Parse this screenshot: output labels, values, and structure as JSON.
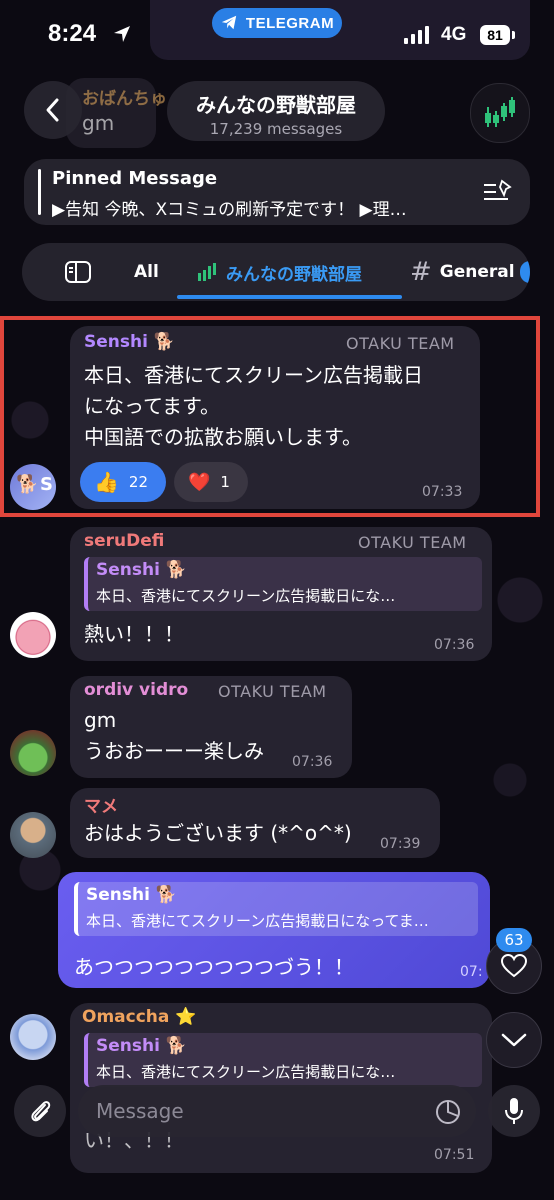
{
  "status_bar": {
    "time": "8:24",
    "network": "4G",
    "battery": "81",
    "app_pill": "TELEGRAM"
  },
  "header": {
    "title": "みんなの野獣部屋",
    "subtitle": "17,239 messages",
    "back_icon": "chevron-left-icon",
    "right_icon": "candlestick-chart-icon"
  },
  "behind_header": {
    "sender": "おばんちゅ",
    "text": "gm"
  },
  "pinned": {
    "title": "Pinned Message",
    "text": "▶告知 今晩、Xコミュの刷新予定です！ ▶理…"
  },
  "tabs": [
    {
      "label": "All",
      "icon": "sidebar-icon"
    },
    {
      "label": "みんなの野獣部屋",
      "icon": "candlestick-chart-icon",
      "active": true
    },
    {
      "label": "General",
      "icon": "hash-icon"
    }
  ],
  "messages": [
    {
      "sender": "Senshi 🐕",
      "team": "OTAKU TEAM",
      "lines": [
        "本日、香港にてスクリーン広告掲載日",
        "になってます。",
        "中国語での拡散お願いします。"
      ],
      "time": "07:33",
      "reactions": [
        {
          "emoji": "👍",
          "count": "22"
        },
        {
          "emoji": "❤️",
          "count": "1"
        }
      ],
      "avatar_badge": "S"
    },
    {
      "sender": "seruDefi",
      "team": "OTAKU TEAM",
      "quote_name": "Senshi 🐕",
      "quote_text": "本日、香港にてスクリーン広告掲載日にな…",
      "lines": [
        "熱い！！！"
      ],
      "time": "07:36"
    },
    {
      "sender": "ordiv vidro",
      "team": "OTAKU TEAM",
      "lines": [
        "gm",
        "うおおーーー楽しみ"
      ],
      "time": "07:36"
    },
    {
      "sender": "マメ",
      "lines": [
        "おはようございます (*^o^*)"
      ],
      "time": "07:39"
    },
    {
      "outgoing": true,
      "quote_name": "Senshi 🐕",
      "quote_text": "本日、香港にてスクリーン広告掲載日になってま…",
      "lines": [
        "あつつつつつつつつつづう！！"
      ],
      "time": "07:"
    },
    {
      "sender": "Omaccha ⭐",
      "quote_name": "Senshi 🐕",
      "quote_text": "本日、香港にてスクリーン広告掲載日にな…",
      "lines": [
        "い！、！！"
      ],
      "time": "07:51"
    }
  ],
  "floating": {
    "reaction_count": "63"
  },
  "composer": {
    "placeholder": "Message"
  },
  "colors": {
    "accent": "#2e8bef",
    "highlight": "#e0463c",
    "outgoing": "#5b55e6",
    "quote_bar": "#b27ef5"
  }
}
